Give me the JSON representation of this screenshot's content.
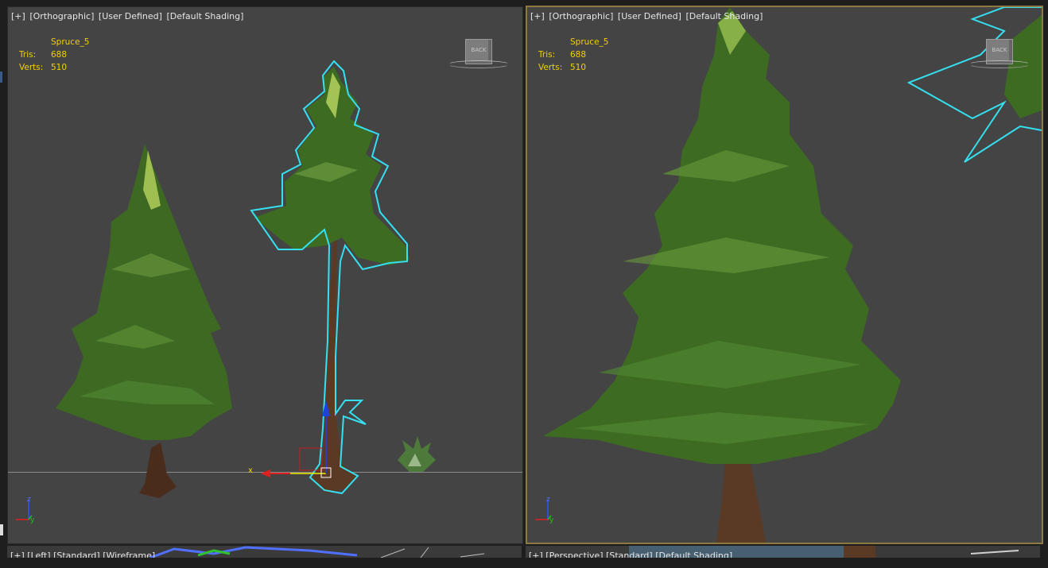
{
  "left_viewport": {
    "label": {
      "plus": "[+]",
      "view": "[Orthographic]",
      "camera": "[User Defined]",
      "shading": "[Default Shading]"
    },
    "stats": {
      "object_name": "Spruce_5",
      "tris_label": "Tris:",
      "tris_value": "688",
      "verts_label": "Verts:",
      "verts_value": "510"
    },
    "viewcube_face": "BACK",
    "gizmo_axis_label": "x",
    "axis_tripod": {
      "z": "z",
      "y": "y"
    }
  },
  "right_viewport": {
    "label": {
      "plus": "[+]",
      "view": "[Orthographic]",
      "camera": "[User Defined]",
      "shading": "[Default Shading]"
    },
    "stats": {
      "object_name": "Spruce_5",
      "tris_label": "Tris:",
      "tris_value": "688",
      "verts_label": "Verts:",
      "verts_value": "510"
    },
    "viewcube_face": "BACK",
    "axis_tripod": {
      "z": "z",
      "y": "y"
    },
    "active": true
  },
  "bottom_left_viewport": {
    "label": "[+] [Left] [Standard] [Wireframe]"
  },
  "bottom_right_viewport": {
    "label": "[+] [Perspective] [Standard] [Default Shading]"
  },
  "colors": {
    "viewport_bg": "#444444",
    "stats_text": "#f0d000",
    "selection_outline": "#35e0f0",
    "active_border": "#8c7a40",
    "foliage": "#3d6b22",
    "trunk": "#5a3a25"
  }
}
